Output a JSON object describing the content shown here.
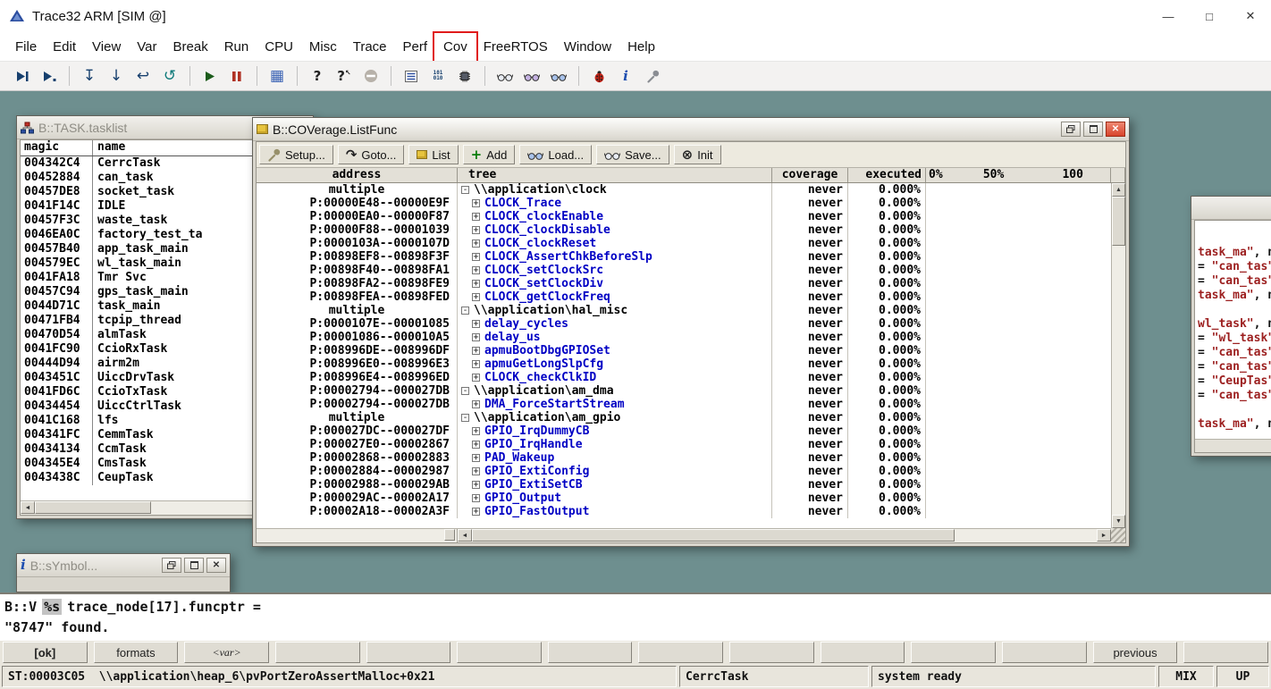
{
  "app": {
    "title": "Trace32 ARM [SIM @]",
    "window_controls": [
      {
        "name": "minimize-button",
        "glyph": "—"
      },
      {
        "name": "maximize-button",
        "glyph": "□"
      },
      {
        "name": "close-button",
        "glyph": "✕"
      }
    ]
  },
  "menubar": {
    "items": [
      "File",
      "Edit",
      "View",
      "Var",
      "Break",
      "Run",
      "CPU",
      "Misc",
      "Trace",
      "Perf",
      "Cov",
      "FreeRTOS",
      "Window",
      "Help"
    ],
    "highlighted_item": "Cov"
  },
  "main_toolbar": {
    "groups": [
      [
        "step-into-icon",
        "step-over-icon"
      ],
      [
        "step-diverge-icon",
        "go-down-icon",
        "go-return-icon",
        "go-up-icon"
      ],
      [
        "go-icon",
        "break-icon"
      ],
      [
        "dump-grid-icon"
      ],
      [
        "help-icon",
        "context-help-icon",
        "stop-icon"
      ],
      [
        "list-icon",
        "binary-dump-icon",
        "chip-icon"
      ],
      [
        "view-data-icon",
        "view-data2-icon",
        "view-data3-icon"
      ],
      [
        "bug-icon",
        "info-icon",
        "tools-icon"
      ]
    ]
  },
  "tasklist_window": {
    "title": "B::TASK.tasklist",
    "columns": [
      "magic",
      "name"
    ],
    "rows": [
      [
        "004342C4",
        "CerrcTask"
      ],
      [
        "00452884",
        "can_task"
      ],
      [
        "00457DE8",
        "socket_task"
      ],
      [
        "0041F14C",
        "IDLE"
      ],
      [
        "00457F3C",
        "waste_task"
      ],
      [
        "0046EA0C",
        "factory_test_ta"
      ],
      [
        "00457B40",
        "app_task_main"
      ],
      [
        "004579EC",
        "wl_task_main"
      ],
      [
        "0041FA18",
        "Tmr Svc"
      ],
      [
        "00457C94",
        "gps_task_main"
      ],
      [
        "0044D71C",
        "task_main"
      ],
      [
        "00471FB4",
        "tcpip_thread"
      ],
      [
        "00470D54",
        "almTask"
      ],
      [
        "0041FC90",
        "CcioRxTask"
      ],
      [
        "00444D94",
        "airm2m"
      ],
      [
        "0043451C",
        "UiccDrvTask"
      ],
      [
        "0041FD6C",
        "CcioTxTask"
      ],
      [
        "00434454",
        "UiccCtrlTask"
      ],
      [
        "0041C168",
        "lfs"
      ],
      [
        "004341FC",
        "CemmTask"
      ],
      [
        "00434134",
        "CcmTask"
      ],
      [
        "004345E4",
        "CmsTask"
      ],
      [
        "0043438C",
        "CeupTask"
      ]
    ]
  },
  "coverage_window": {
    "title": "B::COVerage.ListFunc",
    "toolbar": [
      {
        "icon": "setup-icon",
        "label": "Setup..."
      },
      {
        "icon": "goto-icon",
        "label": "Goto..."
      },
      {
        "icon": "list-box-icon",
        "label": "List"
      },
      {
        "icon": "add-icon",
        "label": "Add"
      },
      {
        "icon": "load-icon",
        "label": "Load..."
      },
      {
        "icon": "save-icon",
        "label": "Save..."
      },
      {
        "icon": "init-icon",
        "label": "Init"
      }
    ],
    "columns": [
      "address",
      "tree",
      "coverage",
      "executed"
    ],
    "percent_labels": [
      "0%",
      "50%",
      "100"
    ],
    "rows": [
      {
        "address": "multiple",
        "tree": "\\\\application\\clock",
        "group": true,
        "coverage": "never",
        "executed": "0.000%"
      },
      {
        "address": "P:00000E48--00000E9F",
        "tree": "CLOCK_Trace",
        "group": false,
        "coverage": "never",
        "executed": "0.000%"
      },
      {
        "address": "P:00000EA0--00000F87",
        "tree": "CLOCK_clockEnable",
        "group": false,
        "coverage": "never",
        "executed": "0.000%"
      },
      {
        "address": "P:00000F88--00001039",
        "tree": "CLOCK_clockDisable",
        "group": false,
        "coverage": "never",
        "executed": "0.000%"
      },
      {
        "address": "P:0000103A--0000107D",
        "tree": "CLOCK_clockReset",
        "group": false,
        "coverage": "never",
        "executed": "0.000%"
      },
      {
        "address": "P:00898EF8--00898F3F",
        "tree": "CLOCK_AssertChkBeforeSlp",
        "group": false,
        "coverage": "never",
        "executed": "0.000%"
      },
      {
        "address": "P:00898F40--00898FA1",
        "tree": "CLOCK_setClockSrc",
        "group": false,
        "coverage": "never",
        "executed": "0.000%"
      },
      {
        "address": "P:00898FA2--00898FE9",
        "tree": "CLOCK_setClockDiv",
        "group": false,
        "coverage": "never",
        "executed": "0.000%"
      },
      {
        "address": "P:00898FEA--00898FED",
        "tree": "CLOCK_getClockFreq",
        "group": false,
        "coverage": "never",
        "executed": "0.000%"
      },
      {
        "address": "multiple",
        "tree": "\\\\application\\hal_misc",
        "group": true,
        "coverage": "never",
        "executed": "0.000%"
      },
      {
        "address": "P:0000107E--00001085",
        "tree": "delay_cycles",
        "group": false,
        "coverage": "never",
        "executed": "0.000%"
      },
      {
        "address": "P:00001086--000010A5",
        "tree": "delay_us",
        "group": false,
        "coverage": "never",
        "executed": "0.000%"
      },
      {
        "address": "P:008996DE--008996DF",
        "tree": "apmuBootDbgGPIOSet",
        "group": false,
        "coverage": "never",
        "executed": "0.000%"
      },
      {
        "address": "P:008996E0--008996E3",
        "tree": "apmuGetLongSlpCfg",
        "group": false,
        "coverage": "never",
        "executed": "0.000%"
      },
      {
        "address": "P:008996E4--008996ED",
        "tree": "CLOCK_checkClkID",
        "group": false,
        "coverage": "never",
        "executed": "0.000%"
      },
      {
        "address": "P:00002794--000027DB",
        "tree": "\\\\application\\am_dma",
        "group": true,
        "coverage": "never",
        "executed": "0.000%"
      },
      {
        "address": "P:00002794--000027DB",
        "tree": "DMA_ForceStartStream",
        "group": false,
        "coverage": "never",
        "executed": "0.000%"
      },
      {
        "address": "multiple",
        "tree": "\\\\application\\am_gpio",
        "group": true,
        "coverage": "never",
        "executed": "0.000%"
      },
      {
        "address": "P:000027DC--000027DF",
        "tree": "GPIO_IrqDummyCB",
        "group": false,
        "coverage": "never",
        "executed": "0.000%"
      },
      {
        "address": "P:000027E0--00002867",
        "tree": "GPIO_IrqHandle",
        "group": false,
        "coverage": "never",
        "executed": "0.000%"
      },
      {
        "address": "P:00002868--00002883",
        "tree": "PAD_Wakeup",
        "group": false,
        "coverage": "never",
        "executed": "0.000%"
      },
      {
        "address": "P:00002884--00002987",
        "tree": "GPIO_ExtiConfig",
        "group": false,
        "coverage": "never",
        "executed": "0.000%"
      },
      {
        "address": "P:00002988--000029AB",
        "tree": "GPIO_ExtiSetCB",
        "group": false,
        "coverage": "never",
        "executed": "0.000%"
      },
      {
        "address": "P:000029AC--00002A17",
        "tree": "GPIO_Output",
        "group": false,
        "coverage": "never",
        "executed": "0.000%"
      },
      {
        "address": "P:00002A18--00002A3F",
        "tree": "GPIO_FastOutput",
        "group": false,
        "coverage": "never",
        "executed": "0.000%"
      }
    ]
  },
  "var_window": {
    "title": "",
    "lines": [
      {
        "pre": "",
        "red": "task_ma\"",
        "post": ", next ="
      },
      {
        "pre": "= ",
        "red": "\"can_tas\"",
        "post": ", nex"
      },
      {
        "pre": "= ",
        "red": "\"can_tas\"",
        "post": ", nex"
      },
      {
        "pre": "",
        "red": "task_ma\"",
        "post": ", next ="
      },
      null,
      {
        "pre": "",
        "red": "wl_task\"",
        "post": ", next ="
      },
      {
        "pre": "= ",
        "red": "\"wl_task\"",
        "post": ", nex"
      },
      {
        "pre": "= ",
        "red": "\"can_tas\"",
        "post": ", nex"
      },
      {
        "pre": "= ",
        "red": "\"can_tas\"",
        "post": ", nex"
      },
      {
        "pre": "= ",
        "red": "\"CeupTas\"",
        "post": ", nex"
      },
      {
        "pre": "= ",
        "red": "\"can_tas\"",
        "post": ", nex"
      },
      null,
      {
        "pre": "",
        "red": "task_ma\"",
        "post": ", next ="
      }
    ]
  },
  "symbol_window": {
    "title": "B::sYmbol..."
  },
  "command_line": {
    "prompt": "B::V",
    "selected_token": "%s",
    "entry": "trace_node[17].funcptr =",
    "result": "\"8747\" found."
  },
  "softkeys": [
    "[ok]",
    "formats",
    "<var>",
    "",
    "",
    "",
    "",
    "",
    "",
    "",
    "",
    "",
    "previous",
    ""
  ],
  "statusbar": {
    "location": "ST:00003C05  \\\\application\\heap_6\\pvPortZeroAssertMalloc+0x21",
    "task": "CerrcTask",
    "status": "system ready",
    "mode": "MIX",
    "direction": "UP"
  }
}
